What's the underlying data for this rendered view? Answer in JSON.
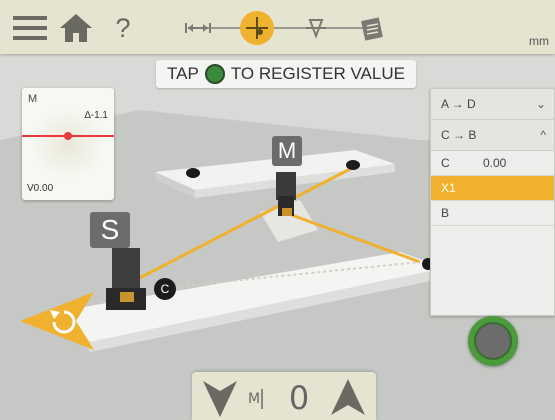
{
  "topbar": {
    "unit": "mm",
    "help_label": "?",
    "menu_icon": "hamburger-menu-icon",
    "home_icon": "home-icon",
    "steps": [
      {
        "icon": "distance-measure-icon",
        "active": false
      },
      {
        "icon": "crosshair-target-icon",
        "active": true
      },
      {
        "icon": "alignment-down-icon",
        "active": false
      },
      {
        "icon": "clipboard-report-icon",
        "active": false
      }
    ]
  },
  "banner": {
    "prefix": "TAP",
    "suffix": "TO REGISTER VALUE"
  },
  "mini_view": {
    "title": "M",
    "deviation": "∆-1.1",
    "value": "V0.00"
  },
  "panel": {
    "headers": [
      {
        "label": "A → D",
        "chevron": "⌄"
      },
      {
        "label": "C → B",
        "chevron": "^"
      }
    ],
    "rows": [
      {
        "label": "C",
        "value": "0.00",
        "active": false
      },
      {
        "label": "X1",
        "value": "",
        "active": true
      },
      {
        "label": "B",
        "value": "",
        "active": false
      }
    ]
  },
  "scene": {
    "marker_m": "M",
    "marker_s": "S",
    "point_c": "C"
  },
  "bottom": {
    "value": "0"
  },
  "colors": {
    "accent_orange": "#f0b12e",
    "register_green": "#4b9a3c",
    "topbar_bg": "#e5e4d1"
  }
}
